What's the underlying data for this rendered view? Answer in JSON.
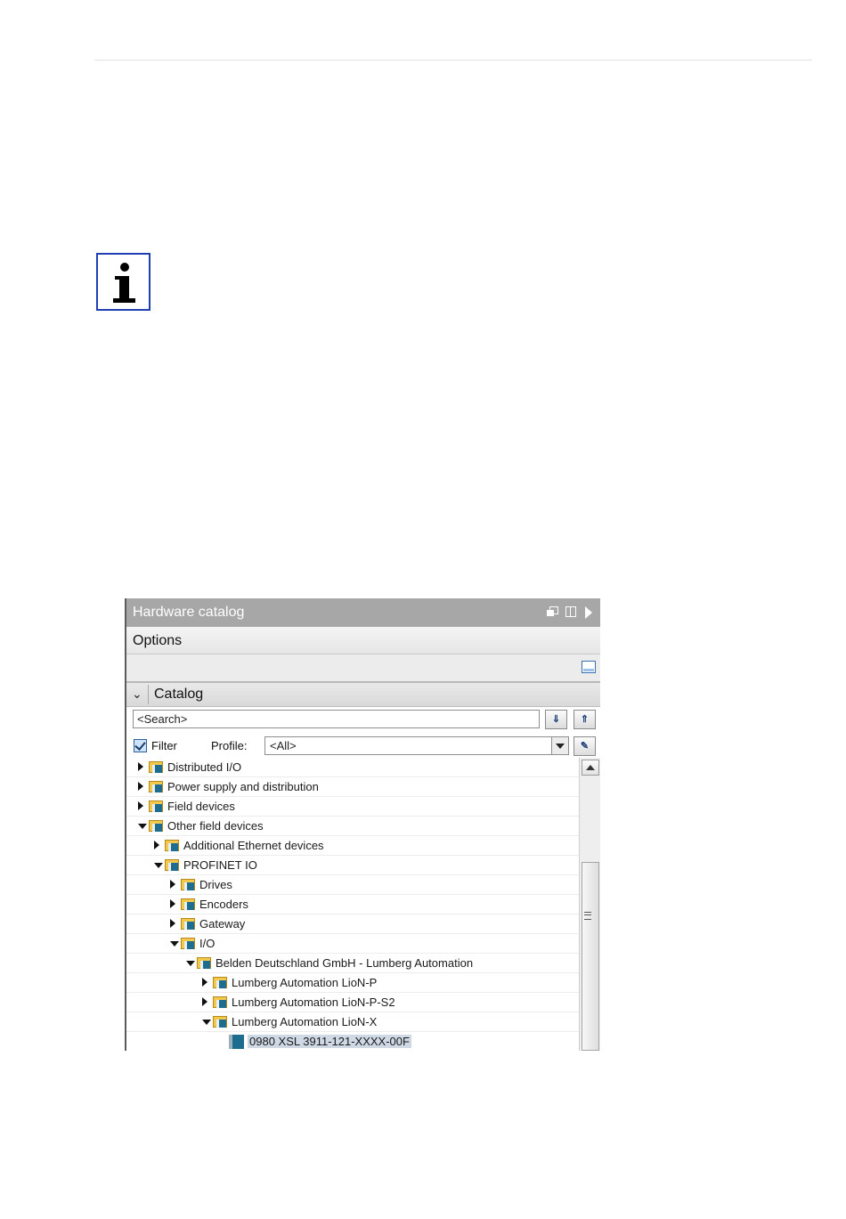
{
  "panel": {
    "title": "Hardware catalog",
    "options_label": "Options",
    "catalog_label": "Catalog",
    "search_placeholder": "<Search>",
    "filter_label": "Filter",
    "profile_label": "Profile:",
    "profile_value": "<All>"
  },
  "tree": [
    {
      "label": "Distributed I/O",
      "level": 0,
      "state": "closed",
      "kind": "folder"
    },
    {
      "label": "Power supply and distribution",
      "level": 0,
      "state": "closed",
      "kind": "folder"
    },
    {
      "label": "Field devices",
      "level": 0,
      "state": "closed",
      "kind": "folder"
    },
    {
      "label": "Other field devices",
      "level": 0,
      "state": "open",
      "kind": "folder"
    },
    {
      "label": "Additional Ethernet devices",
      "level": 1,
      "state": "closed",
      "kind": "folder"
    },
    {
      "label": "PROFINET IO",
      "level": 1,
      "state": "open",
      "kind": "folder"
    },
    {
      "label": "Drives",
      "level": 2,
      "state": "closed",
      "kind": "folder"
    },
    {
      "label": "Encoders",
      "level": 2,
      "state": "closed",
      "kind": "folder"
    },
    {
      "label": "Gateway",
      "level": 2,
      "state": "closed",
      "kind": "folder"
    },
    {
      "label": "I/O",
      "level": 2,
      "state": "open",
      "kind": "folder"
    },
    {
      "label": "Belden Deutschland GmbH - Lumberg Automation",
      "level": 3,
      "state": "open",
      "kind": "folder"
    },
    {
      "label": "Lumberg Automation LioN-P",
      "level": 4,
      "state": "closed",
      "kind": "folder"
    },
    {
      "label": "Lumberg Automation LioN-P-S2",
      "level": 4,
      "state": "closed",
      "kind": "folder"
    },
    {
      "label": "Lumberg Automation LioN-X",
      "level": 4,
      "state": "open",
      "kind": "folder"
    },
    {
      "label": "0980 XSL 3911-121-XXXX-00F",
      "level": 5,
      "state": "leaf",
      "kind": "module",
      "selected": true
    }
  ]
}
